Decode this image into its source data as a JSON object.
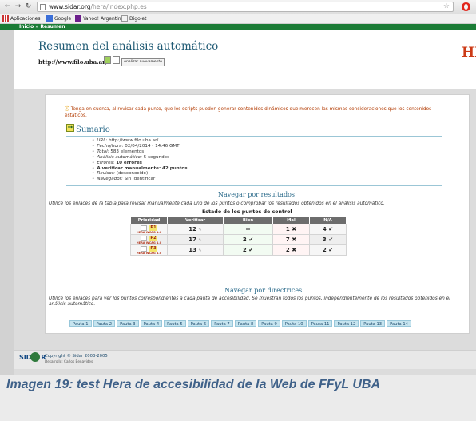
{
  "browser": {
    "url_host": "www.sidar.org",
    "url_path": "/hera/index.php.es",
    "bookmarks": [
      "Aplicaciones",
      "Google",
      "Yahoo! Argentina",
      "Digolet"
    ]
  },
  "page": {
    "breadcrumb": "Inicio » Resumen",
    "title": "Resumen del análisis automático",
    "site_url": "http://www.filo.uba.ar/",
    "reanalyze_label": "Analizar nuevamente",
    "logo_text": "HE"
  },
  "notice": "Tenga en cuenta, al revisar cada punto, que los scripts pueden generar contenidos dinámicos que merecen las mismas consideraciones que los contenidos estáticos.",
  "summary": {
    "title": "Sumario",
    "url_label": "URL:",
    "url_value": "http://www.filo.uba.ar/",
    "date_label": "Fecha/hora:",
    "date_value": "02/04/2014 - 14:46 GMT",
    "total_label": "Total:",
    "total_value": "583 elementos",
    "auto_label": "Análisis automático:",
    "auto_value": "5 segundos",
    "errors_label": "Errores:",
    "errors_value": "10 errores",
    "manual_label": "A verificar manualmente:",
    "manual_value": "42 puntos",
    "reviewer_label": "Revisor:",
    "reviewer_value": "(desconocido)",
    "browser_label": "Navegador:",
    "browser_value": "Sin identificar"
  },
  "results": {
    "title": "Navegar por resultados",
    "desc": "Utilice los enlaces de la tabla para revisar manualmente cada uno de los puntos o comprobar los resultados obtenidos en el análisis automático.",
    "caption": "Estado de los puntos de control",
    "headers": [
      "Prioridad",
      "Verificar",
      "Bien",
      "Mal",
      "N/A"
    ],
    "rows": [
      {
        "priority": "P1",
        "verify": "12",
        "bien": "--",
        "mal": "1",
        "na": "4"
      },
      {
        "priority": "P2",
        "verify": "17",
        "bien": "2",
        "mal": "7",
        "na": "3"
      },
      {
        "priority": "P3",
        "verify": "13",
        "bien": "2",
        "mal": "2",
        "na": "2"
      }
    ],
    "wcag_label": "WCAG 1.0",
    "hera_label": "HERA"
  },
  "directives": {
    "title": "Navegar por directrices",
    "desc": "Utilice los enlaces para ver los puntos correspondientes a cada pauta de accesibilidad. Se muestran todos los puntos, independientemente de los resultados obtenidos en el análisis automático.",
    "pautas": [
      "Pauta 1",
      "Pauta 2",
      "Pauta 3",
      "Pauta 4",
      "Pauta 5",
      "Pauta 6",
      "Pauta 7",
      "Pauta 8",
      "Pauta 9",
      "Pauta 10",
      "Pauta 11",
      "Pauta 12",
      "Pauta 13",
      "Pauta 14"
    ]
  },
  "footer": {
    "logo": "SID",
    "logo_end": "R",
    "copyright": "Copyright © Sidar 2003-2005",
    "developer": "Desarrollo: Carlos Benavides"
  },
  "caption": "Imagen 19: test Hera de accesibilidad de la Web de FFyL UBA"
}
